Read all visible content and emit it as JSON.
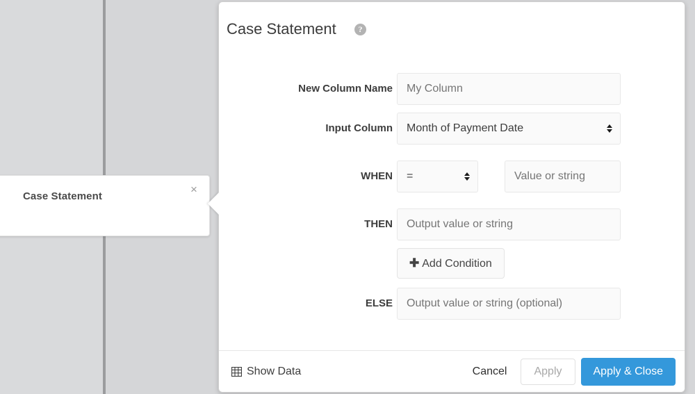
{
  "canvas": {
    "node_card": {
      "label": "Case Statement",
      "close_icon": "close-icon",
      "close_glyph": "×"
    }
  },
  "modal": {
    "title": "Case Statement",
    "help_icon": "help-icon",
    "help_glyph": "?",
    "fields": {
      "new_column_name": {
        "label": "New Column Name",
        "value": "",
        "placeholder": "My Column"
      },
      "input_column": {
        "label": "Input Column",
        "selected": "Month of Payment Date"
      },
      "when": {
        "label": "WHEN",
        "operator": "=",
        "value": "",
        "value_placeholder": "Value or string"
      },
      "then": {
        "label": "THEN",
        "value": "",
        "placeholder": "Output value or string"
      },
      "add_condition": {
        "label": "Add Condition",
        "plus_glyph": "✚"
      },
      "else": {
        "label": "ELSE",
        "value": "",
        "placeholder": "Output value or string (optional)"
      }
    },
    "footer": {
      "show_data_label": "Show Data",
      "show_data_icon": "table-grid-icon",
      "cancel_label": "Cancel",
      "apply_label": "Apply",
      "apply_close_label": "Apply & Close"
    }
  },
  "colors": {
    "primary": "#3498db",
    "canvas_bg": "#d5d6d8",
    "divider": "#9b9c9e",
    "field_bg": "#fafafa",
    "placeholder": "#b7b7b7"
  }
}
